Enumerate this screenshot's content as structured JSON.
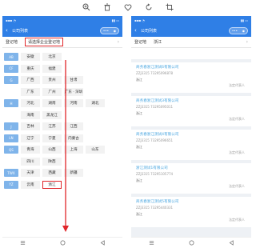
{
  "left": {
    "title": "公司列表",
    "reg_label": "登记地",
    "reg_placeholder": "请选择企业登记地",
    "rows": [
      {
        "tag": "AB",
        "cells": [
          "安徽",
          "北京"
        ]
      },
      {
        "tag": "CF",
        "cells": [
          "重庆",
          "福建"
        ]
      },
      {
        "tag": "G",
        "cells": [
          "广西",
          "贵州",
          "甘肃"
        ]
      },
      {
        "tag": "",
        "cells": [
          "广东",
          "广州",
          "广东 · 深圳"
        ]
      },
      {
        "tag": "H",
        "cells": [
          "河北",
          "湖南",
          "河南",
          "湖北"
        ]
      },
      {
        "tag": "",
        "cells": [
          "海南",
          "黑龙江"
        ]
      },
      {
        "tag": "J",
        "cells": [
          "吉林",
          "江苏",
          "江西"
        ]
      },
      {
        "tag": "LN",
        "cells": [
          "辽宁",
          "宁夏",
          "内蒙古"
        ]
      },
      {
        "tag": "QS",
        "cells": [
          "青海",
          "山西",
          "上海",
          "山东"
        ]
      },
      {
        "tag": "",
        "cells": [
          "四川",
          "陕西"
        ]
      },
      {
        "tag": "TWX",
        "cells": [
          "天津",
          "西藏",
          "新疆"
        ]
      },
      {
        "tag": "YZ",
        "cells": [
          "云南",
          "浙江"
        ]
      }
    ],
    "highlight": "浙江"
  },
  "right": {
    "title": "公司列表",
    "reg_label": "登记地",
    "reg_value": "浙江",
    "cards": [
      {
        "name": "商务春浙江测试6有限公司",
        "code": "ZZJ3315 73295096878",
        "prov": "浙江",
        "role": "法定代表人"
      },
      {
        "name": "商务春浙江测试3有限公司",
        "code": "ZZJ3315 73295095011",
        "prov": "浙江",
        "role": "法定代表人"
      },
      {
        "name": "商务春浙江测试4有限公司",
        "code": "ZZJ3315 73295096651",
        "prov": "浙江",
        "role": "法定代表人"
      },
      {
        "name": "浙江测试1有限公司",
        "code": "ZZJ3315 73295105774",
        "prov": "浙江",
        "role": "法定代表人"
      },
      {
        "name": "商务春浙江测试5有限公司",
        "code": "ZZJ3315 73295440331",
        "prov": "浙江",
        "role": "法定代表人"
      }
    ]
  },
  "icons": {
    "viewer": [
      "zoom-in-icon",
      "delete-icon",
      "favorite-icon",
      "rotate-icon",
      "crop-icon"
    ],
    "nav": [
      "menu-icon",
      "home-icon",
      "back-icon"
    ]
  },
  "colors": {
    "primary": "#2f7fe6",
    "highlight_red": "#e0262a",
    "tag_blue": "#7fb4ea",
    "link_blue": "#4aa6e0"
  }
}
